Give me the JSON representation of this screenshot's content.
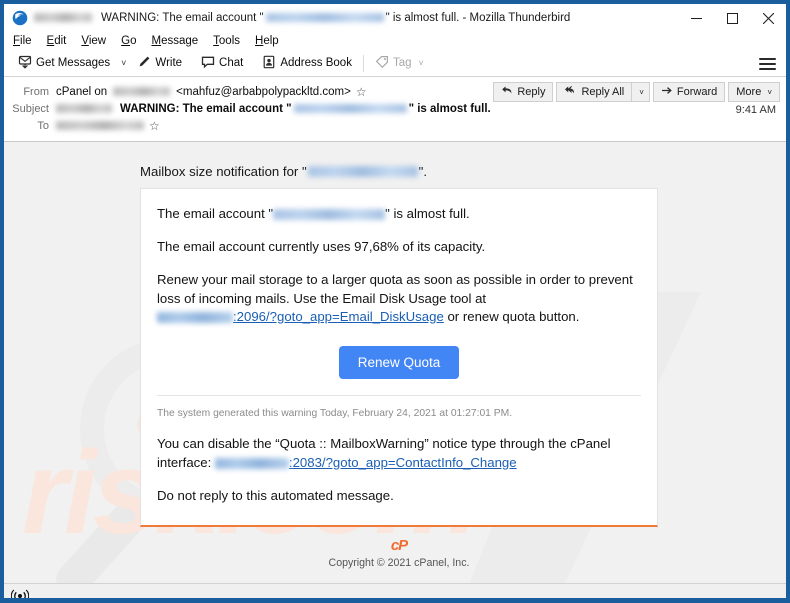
{
  "window": {
    "title_prefix_redacted": true,
    "title": "WARNING: The email account \"",
    "title_mid": "\" is almost full. - Mozilla Thunderbird",
    "app_icon": "thunderbird-icon",
    "minimize_label": "Minimize",
    "maximize_label": "Maximize",
    "close_label": "Close",
    "border_color": "#1b5e9e"
  },
  "menubar": {
    "items": [
      {
        "pre": "",
        "key": "F",
        "post": "ile"
      },
      {
        "pre": "",
        "key": "E",
        "post": "dit"
      },
      {
        "pre": "",
        "key": "V",
        "post": "iew"
      },
      {
        "pre": "",
        "key": "G",
        "post": "o"
      },
      {
        "pre": "",
        "key": "M",
        "post": "essage"
      },
      {
        "pre": "",
        "key": "T",
        "post": "ools"
      },
      {
        "pre": "",
        "key": "H",
        "post": "elp"
      }
    ]
  },
  "toolbar": {
    "get_messages": "Get Messages",
    "get_messages_icon": "download-mail-icon",
    "get_messages_caret": "˅",
    "write": "Write",
    "write_icon": "pencil-icon",
    "chat": "Chat",
    "chat_icon": "chat-bubble-icon",
    "address_book": "Address Book",
    "address_book_icon": "address-book-icon",
    "tag": "Tag",
    "tag_icon": "tag-icon",
    "tag_caret": "˅",
    "app_menu_icon": "hamburger-menu-icon"
  },
  "message_header": {
    "from_label": "From",
    "from_value_prefix": "cPanel on",
    "from_value_suffix": "<mahfuz@arbabpolypackltd.com>",
    "from_star_icon": "star-icon",
    "subject_label": "Subject",
    "subject_value": "WARNING: The email account \"",
    "subject_value_end": "\" is almost full.",
    "to_label": "To",
    "to_star_icon": "star-icon",
    "time": "9:41 AM",
    "actions": {
      "reply": "Reply",
      "reply_icon": "reply-arrow-icon",
      "reply_all": "Reply All",
      "reply_all_icon": "reply-all-arrow-icon",
      "reply_all_caret": "˅",
      "forward": "Forward",
      "forward_icon": "forward-arrow-icon",
      "more": "More",
      "more_caret": "˅"
    }
  },
  "mail_body": {
    "intro_prefix": "Mailbox size notification for \"",
    "intro_suffix": "\".",
    "line1_prefix": "The email account \"",
    "line1_suffix": "\" is almost full.",
    "line2": "The email account currently uses 97,68% of its capacity.",
    "usage_percent": "97,68%",
    "line3_part1": "Renew your mail storage to a larger quota as soon as possible in order to prevent loss of incoming mails. Use the Email Disk Usage tool at",
    "line3_link": ":2096/?goto_app=Email_DiskUsage",
    "line3_part2": "or renew quota button.",
    "renew_button": "Renew Quota",
    "renew_button_color": "#4285f4",
    "system_note": "The system generated this warning Today, February 24, 2021 at 01:27:01 PM.",
    "disable_part1": "You can disable the “Quota :: MailboxWarning” notice type through the cPanel interface:",
    "disable_link": ":2083/?goto_app=ContactInfo_Change",
    "no_reply": "Do not reply to this automated message.",
    "accent_color": "#ef7a3a"
  },
  "mail_footer": {
    "logo_text": "cP",
    "logo_color": "#ef6c2e",
    "copyright": "Copyright ©   2021 cPanel, Inc."
  },
  "watermark": {
    "text": "risk.com",
    "color": "#fae6dc",
    "glass_icon": "magnifier-watermark-icon"
  },
  "statusbar": {
    "icon": "broadcast-activity-icon"
  }
}
